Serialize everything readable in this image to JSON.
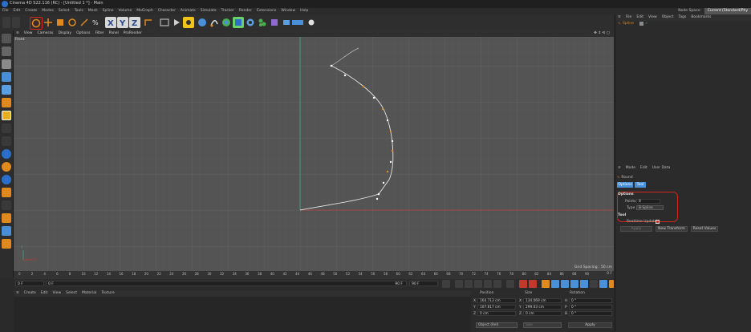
{
  "window": {
    "title": "Cinema 4D S22.116 (RC) - [Untitled 1 *] - Main"
  },
  "menubar": {
    "items": [
      "File",
      "Edit",
      "Create",
      "Modes",
      "Select",
      "Tools",
      "Mesh",
      "Spline",
      "Volume",
      "MoGraph",
      "Character",
      "Animate",
      "Simulate",
      "Tracker",
      "Render",
      "Extensions",
      "Window",
      "Help"
    ],
    "node_space": "Node Space:",
    "node_space_value": "Current (Standard/Phy"
  },
  "viewport": {
    "menu": [
      "View",
      "Cameras",
      "Display",
      "Options",
      "Filter",
      "Panel",
      "ProRender"
    ],
    "label": "Front",
    "grid_spacing": "Grid Spacing : 50 cm",
    "axis_y": "Y",
    "axis_x": "X"
  },
  "timeline": {
    "ticks": [
      "0",
      "2",
      "4",
      "6",
      "8",
      "10",
      "12",
      "14",
      "16",
      "18",
      "20",
      "22",
      "24",
      "26",
      "28",
      "30",
      "32",
      "34",
      "36",
      "38",
      "40",
      "42",
      "44",
      "46",
      "48",
      "50",
      "52",
      "54",
      "56",
      "58",
      "60",
      "62",
      "64",
      "66",
      "68",
      "70",
      "72",
      "74",
      "76",
      "78",
      "80",
      "82",
      "84",
      "86",
      "88",
      "90"
    ],
    "current_frame": "0 F"
  },
  "transport": {
    "start": "0 F",
    "start2": "0 F",
    "end": "90 F",
    "end2": "90 F"
  },
  "material_menu": [
    "Create",
    "Edit",
    "View",
    "Select",
    "Material",
    "Texture"
  ],
  "coords": {
    "headers": [
      "Position",
      "Size",
      "Rotation"
    ],
    "rows": [
      {
        "axis": "X",
        "pos": "164.713 cm",
        "size_axis": "X",
        "size": "134.069 cm",
        "rot_axis": "H",
        "rot": "0 °"
      },
      {
        "axis": "Y",
        "pos": "107.617 cm",
        "size_axis": "Y",
        "size": "299.03 cm",
        "rot_axis": "P",
        "rot": "0 °"
      },
      {
        "axis": "Z",
        "pos": "0 cm",
        "size_axis": "Z",
        "size": "0 cm",
        "rot_axis": "B",
        "rot": "0 °"
      }
    ],
    "mode": "Object (Rel)",
    "size_mode": "Size",
    "apply": "Apply"
  },
  "object_manager": {
    "menu": [
      "File",
      "Edit",
      "View",
      "Object",
      "Tags",
      "Bookmarks"
    ],
    "object": "Spline"
  },
  "attributes": {
    "menu": [
      "Mode",
      "Edit",
      "User Data"
    ],
    "tool_name": "Round",
    "tabs": [
      "Options",
      "Tool"
    ],
    "options_header": "Options",
    "points_label": "Points",
    "points_value": "8",
    "type_label": "Type",
    "type_value": "B-Spline",
    "tool_header": "Tool",
    "realtime_label": "Realtime Update",
    "apply_btn": "Apply",
    "new_transform_btn": "New Transform",
    "reset_btn": "Reset Values"
  },
  "colors": {
    "accent_blue": "#4a90d9",
    "highlight_red": "#d0281e",
    "grid_bg": "#545454",
    "spline": "#e6e6e6",
    "y_axis": "#3fae7a",
    "x_axis": "#b24747"
  }
}
